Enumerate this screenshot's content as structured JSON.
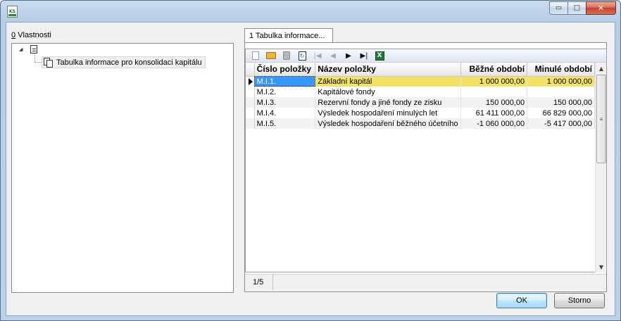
{
  "window": {
    "app_icon": "report-app-icon",
    "controls": {
      "minimize": "▭",
      "maximize": "□",
      "close": "✕"
    }
  },
  "left": {
    "label_key": "0",
    "label_rest": " Vlastnosti",
    "tree": {
      "root_icon": "document-icon",
      "child_label": "Tabulka informace pro konsolidaci kapitálu"
    }
  },
  "tab": {
    "label": "1 Tabulka informace..."
  },
  "toolbar": {
    "icons": [
      "new-document-icon",
      "open-folder-icon",
      "delete-icon",
      "refresh-icon",
      "first-record-icon",
      "previous-record-icon",
      "next-record-icon",
      "last-record-icon",
      "excel-export-icon"
    ],
    "first": "|◀",
    "prev": "◀",
    "next": "▶",
    "last": "▶|",
    "excel": "X"
  },
  "table": {
    "columns": [
      "Číslo položky",
      "Název položky",
      "Běžné období",
      "Minulé období"
    ],
    "rows": [
      {
        "code": "M.I.1.",
        "name": "Základní kapitál",
        "current": "1 000 000,00",
        "previous": "1 000 000,00"
      },
      {
        "code": "M.I.2.",
        "name": "Kapitálové fondy",
        "current": "",
        "previous": ""
      },
      {
        "code": "M.I.3.",
        "name": "Rezervní fondy a jiné fondy ze zisku",
        "current": "150 000,00",
        "previous": "150 000,00"
      },
      {
        "code": "M.I.4.",
        "name": "Výsledek hospodaření minulých let",
        "current": "61 411 000,00",
        "previous": "66 829 000,00"
      },
      {
        "code": "M.I.5.",
        "name": "Výsledek hospodaření běžného účetního",
        "current": "-1 060 000,00",
        "previous": "-5 417 000,00"
      }
    ],
    "selected_row": 0
  },
  "scrollbar": {
    "up": "▲",
    "down": "▼",
    "grip": "≡"
  },
  "status": {
    "record_position": "1/5"
  },
  "buttons": {
    "ok": "OK",
    "cancel": "Storno"
  },
  "colors": {
    "selected_row": "#f4e264",
    "selected_cell": "#3399ff"
  }
}
